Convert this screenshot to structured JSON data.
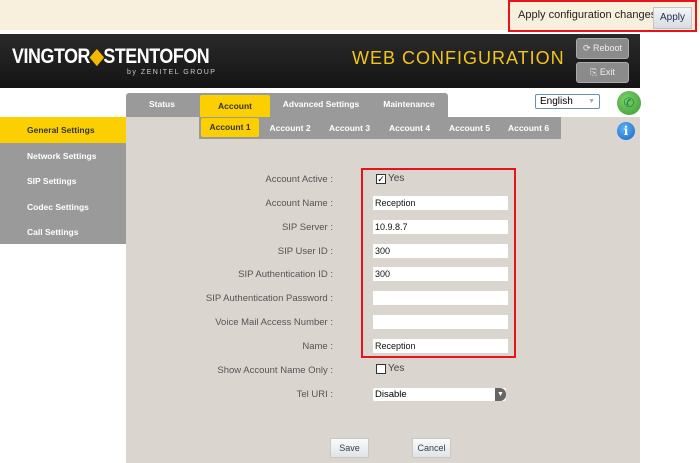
{
  "apply_bar": {
    "message": "Apply configuration changes.",
    "apply_label": "Apply"
  },
  "header": {
    "logo_left": "VINGTOR",
    "logo_right": "STENTOFON",
    "logo_sub": "by ZENITEL GROUP",
    "title": "WEB CONFIGURATION",
    "reboot_label": "Reboot",
    "exit_label": "Exit"
  },
  "main_tabs": [
    {
      "label": "Status"
    },
    {
      "label": "Account",
      "active": true
    },
    {
      "label": "Advanced Settings"
    },
    {
      "label": "Maintenance"
    }
  ],
  "language": {
    "selected": "English"
  },
  "sidebar": {
    "items": [
      {
        "label": "General Settings",
        "active": true
      },
      {
        "label": "Network Settings"
      },
      {
        "label": "SIP Settings"
      },
      {
        "label": "Codec Settings"
      },
      {
        "label": "Call Settings"
      }
    ]
  },
  "sub_tabs": [
    {
      "label": "Account 1",
      "active": true
    },
    {
      "label": "Account 2"
    },
    {
      "label": "Account 3"
    },
    {
      "label": "Account 4"
    },
    {
      "label": "Account 5"
    },
    {
      "label": "Account 6"
    }
  ],
  "form": {
    "account_active": {
      "label": "Account Active :",
      "checked": true,
      "text": "Yes"
    },
    "account_name": {
      "label": "Account Name :",
      "value": "Reception"
    },
    "sip_server": {
      "label": "SIP Server :",
      "value": "10.9.8.7"
    },
    "sip_user_id": {
      "label": "SIP User ID :",
      "value": "300"
    },
    "sip_auth_id": {
      "label": "SIP Authentication ID :",
      "value": "300"
    },
    "sip_auth_password": {
      "label": "SIP Authentication Password :",
      "value": ""
    },
    "voicemail_number": {
      "label": "Voice Mail Access Number :",
      "value": ""
    },
    "name": {
      "label": "Name :",
      "value": "Reception"
    },
    "show_account_name_only": {
      "label": "Show Account Name Only :",
      "checked": false,
      "text": "Yes"
    },
    "tel_uri": {
      "label": "Tel URI :",
      "value": "Disable"
    }
  },
  "buttons": {
    "save": "Save",
    "cancel": "Cancel"
  },
  "colors": {
    "accent": "#fcd000",
    "highlight_box": "#e8121b",
    "panel": "#dbd5cf"
  }
}
